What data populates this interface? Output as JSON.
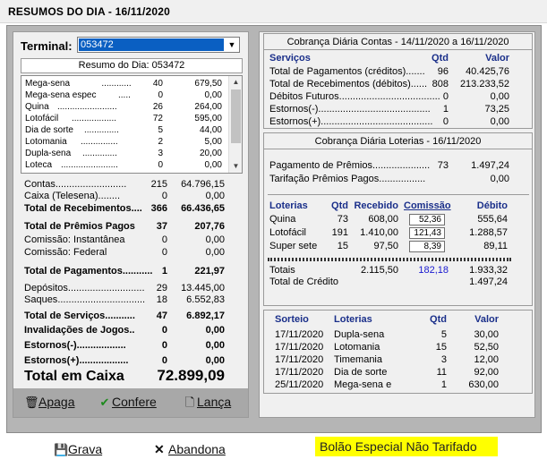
{
  "window": {
    "title": "RESUMOS DO DIA - 16/11/2020"
  },
  "left": {
    "terminal_label": "Terminal:",
    "terminal_value": "053472",
    "resumo_header": "Resumo do Dia: 053472",
    "games": [
      {
        "name": "Mega-sena",
        "qtd": "40",
        "valor": "679,50"
      },
      {
        "name": "Mega-sena espec",
        "qtd": "0",
        "valor": "0,00"
      },
      {
        "name": "Quina",
        "qtd": "26",
        "valor": "264,00"
      },
      {
        "name": "Lotofácil",
        "qtd": "72",
        "valor": "595,00"
      },
      {
        "name": "Dia de sorte",
        "qtd": "5",
        "valor": "44,00"
      },
      {
        "name": "Lotomania",
        "qtd": "2",
        "valor": "5,00"
      },
      {
        "name": "Dupla-sena",
        "qtd": "3",
        "valor": "20,00"
      },
      {
        "name": "Loteca",
        "qtd": "0",
        "valor": "0,00"
      }
    ],
    "summary": [
      {
        "label": "Contas",
        "qtd": "215",
        "valor": "64.796,15",
        "bold": false
      },
      {
        "label": "Caixa (Telesena)",
        "qtd": "0",
        "valor": "0,00",
        "bold": false
      },
      {
        "label": "Total de Recebimentos",
        "qtd": "366",
        "valor": "66.436,65",
        "bold": true
      },
      {
        "label": "Total de Prêmios Pagos",
        "qtd": "37",
        "valor": "207,76",
        "bold": true
      },
      {
        "label": "Comissão: Instantânea",
        "qtd": "0",
        "valor": "0,00",
        "bold": false
      },
      {
        "label": "Comissão: Federal",
        "qtd": "0",
        "valor": "0,00",
        "bold": false
      },
      {
        "label": "Total de Pagamentos",
        "qtd": "1",
        "valor": "221,97",
        "bold": true
      },
      {
        "label": "Depósitos",
        "qtd": "29",
        "valor": "13.445,00",
        "bold": false
      },
      {
        "label": "Saques",
        "qtd": "18",
        "valor": "6.552,83",
        "bold": false
      },
      {
        "label": "Total de Serviços",
        "qtd": "47",
        "valor": "6.892,17",
        "bold": true
      },
      {
        "label": "Invalidações de Jogos",
        "qtd": "0",
        "valor": "0,00",
        "bold": true
      },
      {
        "label": "Estornos(-)",
        "qtd": "0",
        "valor": "0,00",
        "bold": true
      },
      {
        "label": "Estornos(+)",
        "qtd": "0",
        "valor": "0,00",
        "bold": true
      }
    ],
    "total_caixa_label": "Total em Caixa",
    "total_caixa_value": "72.899,09",
    "buttons": {
      "apaga": "Apaga",
      "confere": "Confere",
      "lanca": "Lança"
    }
  },
  "right": {
    "contas": {
      "header": "Cobrança Diária Contas - 14/11/2020 a 16/11/2020",
      "col_servicos": "Serviços",
      "col_qtd": "Qtd",
      "col_valor": "Valor",
      "rows": [
        {
          "label": "Total de Pagamentos (créditos)",
          "qtd": "96",
          "valor": "40.425,76"
        },
        {
          "label": "Total de Recebimentos (débitos)",
          "qtd": "808",
          "valor": "213.233,52"
        },
        {
          "label": "Débitos Futuros",
          "qtd": "0",
          "valor": "0,00"
        },
        {
          "label": "Estornos(-)",
          "qtd": "1",
          "valor": "73,25"
        },
        {
          "label": "Estornos(+)",
          "qtd": "0",
          "valor": "0,00"
        }
      ]
    },
    "loterias": {
      "header": "Cobrança Diária Loterias - 16/11/2020",
      "pagamento_label": "Pagamento de Prêmios",
      "pagamento_qtd": "73",
      "pagamento_valor": "1.497,24",
      "tarifacao_label": "Tarifação Prêmios Pagos",
      "tarifacao_valor": "0,00",
      "col_loterias": "Loterias",
      "col_qtd": "Qtd",
      "col_recebido": "Recebido",
      "col_comissao": "Comissão",
      "col_debito": "Débito",
      "rows": [
        {
          "name": "Quina",
          "qtd": "73",
          "recebido": "608,00",
          "comissao": "52,36",
          "debito": "555,64"
        },
        {
          "name": "Lotofácil",
          "qtd": "191",
          "recebido": "1.410,00",
          "comissao": "121,43",
          "debito": "1.288,57"
        },
        {
          "name": "Super sete",
          "qtd": "15",
          "recebido": "97,50",
          "comissao": "8,39",
          "debito": "89,11"
        }
      ],
      "totais_label": "Totais",
      "totais_recebido": "2.115,50",
      "totais_comissao": "182,18",
      "totais_debito": "1.933,32",
      "credito_label": "Total de Crédito",
      "credito_valor": "1.497,24"
    },
    "sorteio": {
      "col_sorteio": "Sorteio",
      "col_loterias": "Loterias",
      "col_qtd": "Qtd",
      "col_valor": "Valor",
      "rows": [
        {
          "data": "17/11/2020",
          "loteria": "Dupla-sena",
          "qtd": "5",
          "valor": "30,00"
        },
        {
          "data": "17/11/2020",
          "loteria": "Lotomania",
          "qtd": "15",
          "valor": "52,50"
        },
        {
          "data": "17/11/2020",
          "loteria": "Timemania",
          "qtd": "3",
          "valor": "12,00"
        },
        {
          "data": "17/11/2020",
          "loteria": "Dia de sorte",
          "qtd": "11",
          "valor": "92,00"
        },
        {
          "data": "25/11/2020",
          "loteria": "Mega-sena e",
          "qtd": "1",
          "valor": "630,00"
        }
      ]
    }
  },
  "bottom": {
    "grava": "Grava",
    "abandona": "Abandona",
    "bolao": "Bolão Especial Não Tarifado"
  }
}
